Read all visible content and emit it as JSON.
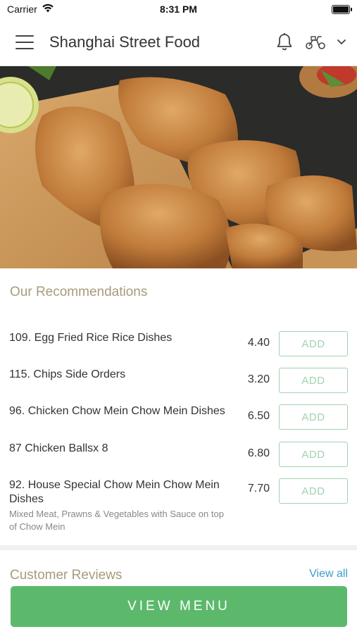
{
  "status_bar": {
    "carrier": "Carrier",
    "time": "8:31 PM"
  },
  "header": {
    "title": "Shanghai Street Food",
    "icons": [
      "menu-icon",
      "bell-icon",
      "scooter-icon",
      "chevron-down-icon"
    ]
  },
  "recommendations": {
    "title": "Our Recommendations",
    "items": [
      {
        "name": "109. Egg Fried Rice Rice Dishes",
        "description": "",
        "price": "4.40",
        "button": "ADD"
      },
      {
        "name": "115. Chips Side Orders",
        "description": "",
        "price": "3.20",
        "button": "ADD"
      },
      {
        "name": "96. Chicken Chow Mein Chow Mein Dishes",
        "description": "",
        "price": "6.50",
        "button": "ADD"
      },
      {
        "name": "87 Chicken Ballsx 8",
        "description": "",
        "price": "6.80",
        "button": "ADD"
      },
      {
        "name": "92. House Special Chow Mein Chow Mein Dishes",
        "description": "Mixed Meat, Prawns & Vegetables with Sauce on top of Chow Mein",
        "price": "7.70",
        "button": "ADD"
      }
    ]
  },
  "reviews": {
    "title": "Customer Reviews",
    "view_all": "View all"
  },
  "footer": {
    "view_menu": "VIEW MENU"
  },
  "colors": {
    "accent_green": "#5cb96b",
    "add_border": "#9fd3ad",
    "section_title": "#a89a7c",
    "link_blue": "#3aa0c8"
  }
}
